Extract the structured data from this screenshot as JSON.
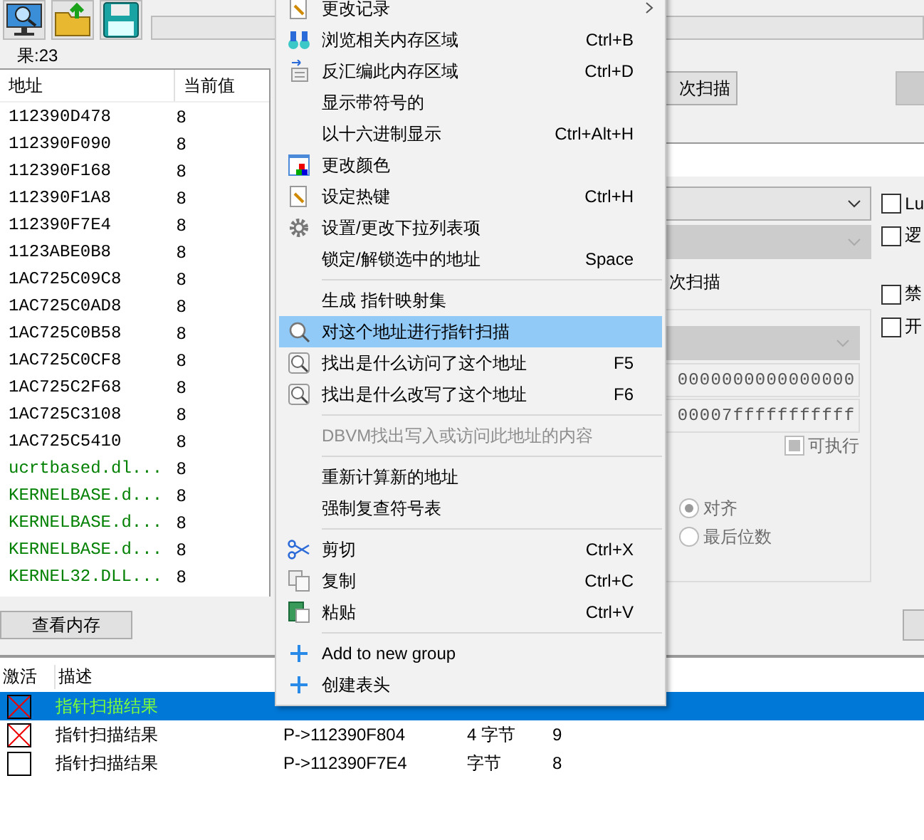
{
  "scan_progress": {
    "level": 0
  },
  "scan_results": {
    "count_label": "果:23",
    "columns": [
      "地址",
      "当前值"
    ],
    "rows": [
      {
        "address": "112390D478",
        "value": "8",
        "color": "#000000"
      },
      {
        "address": "112390F090",
        "value": "8",
        "color": "#000000"
      },
      {
        "address": "112390F168",
        "value": "8",
        "color": "#000000"
      },
      {
        "address": "112390F1A8",
        "value": "8",
        "color": "#000000"
      },
      {
        "address": "112390F7E4",
        "value": "8",
        "color": "#000000"
      },
      {
        "address": "1123ABE0B8",
        "value": "8",
        "color": "#000000"
      },
      {
        "address": "1AC725C09C8",
        "value": "8",
        "color": "#000000"
      },
      {
        "address": "1AC725C0AD8",
        "value": "8",
        "color": "#000000"
      },
      {
        "address": "1AC725C0B58",
        "value": "8",
        "color": "#000000"
      },
      {
        "address": "1AC725C0CF8",
        "value": "8",
        "color": "#000000"
      },
      {
        "address": "1AC725C2F68",
        "value": "8",
        "color": "#000000"
      },
      {
        "address": "1AC725C3108",
        "value": "8",
        "color": "#000000"
      },
      {
        "address": "1AC725C5410",
        "value": "8",
        "color": "#000000"
      },
      {
        "address": "ucrtbased.dl...",
        "value": "8",
        "color": "#008000"
      },
      {
        "address": "KERNELBASE.d...",
        "value": "8",
        "color": "#008000"
      },
      {
        "address": "KERNELBASE.d...",
        "value": "8",
        "color": "#008000"
      },
      {
        "address": "KERNELBASE.d...",
        "value": "8",
        "color": "#008000"
      },
      {
        "address": "KERNEL32.DLL...",
        "value": "8",
        "color": "#008000"
      }
    ],
    "view_memory_button": "查看内存"
  },
  "scan_panel": {
    "next_scan_button": "次扫描",
    "dropdowns": [
      {
        "disabled": false
      },
      {
        "disabled": true
      }
    ],
    "label": "次扫描",
    "options": [
      {
        "label": "Lu",
        "checked": false
      },
      {
        "label": "逻",
        "checked": false
      },
      {
        "label": "禁",
        "checked": false
      },
      {
        "label": "开",
        "checked": false
      }
    ],
    "memory_region": {
      "start": "0000000000000000",
      "stop": "00007fffffffffff",
      "executable_label": "可执行",
      "executable_checked": true,
      "radios": [
        {
          "label": "对齐",
          "selected": true
        },
        {
          "label": "最后位数",
          "selected": false
        }
      ]
    }
  },
  "context_menu": [
    {
      "kind": "item",
      "label": "更改记录",
      "selected": false,
      "disabled": false,
      "submenu": true
    },
    {
      "kind": "item",
      "label": "浏览相关内存区域",
      "shortcut": "Ctrl+B",
      "selected": false,
      "disabled": false,
      "submenu": false
    },
    {
      "kind": "item",
      "label": "反汇编此内存区域",
      "shortcut": "Ctrl+D",
      "selected": false,
      "disabled": false,
      "submenu": false
    },
    {
      "kind": "item",
      "label": "显示带符号的",
      "selected": false,
      "disabled": false,
      "submenu": false
    },
    {
      "kind": "item",
      "label": "以十六进制显示",
      "shortcut": "Ctrl+Alt+H",
      "selected": false,
      "disabled": false,
      "submenu": false
    },
    {
      "kind": "item",
      "label": "更改颜色",
      "selected": false,
      "disabled": false,
      "submenu": false
    },
    {
      "kind": "item",
      "label": "设定热键",
      "shortcut": "Ctrl+H",
      "selected": false,
      "disabled": false,
      "submenu": false
    },
    {
      "kind": "item",
      "label": "设置/更改下拉列表项",
      "selected": false,
      "disabled": false,
      "submenu": false
    },
    {
      "kind": "item",
      "label": "锁定/解锁选中的地址",
      "shortcut": "Space",
      "selected": false,
      "disabled": false,
      "submenu": false
    },
    {
      "kind": "separator"
    },
    {
      "kind": "item",
      "label": "生成 指针映射集",
      "selected": false,
      "disabled": false,
      "submenu": false
    },
    {
      "kind": "item",
      "label": "对这个地址进行指针扫描",
      "selected": true,
      "disabled": false,
      "submenu": false
    },
    {
      "kind": "item",
      "label": "找出是什么访问了这个地址",
      "shortcut": "F5",
      "selected": false,
      "disabled": false,
      "submenu": false
    },
    {
      "kind": "item",
      "label": "找出是什么改写了这个地址",
      "shortcut": "F6",
      "selected": false,
      "disabled": false,
      "submenu": false
    },
    {
      "kind": "separator"
    },
    {
      "kind": "item",
      "label": "DBVM找出写入或访问此地址的内容",
      "selected": false,
      "disabled": true,
      "submenu": false
    },
    {
      "kind": "separator"
    },
    {
      "kind": "item",
      "label": "重新计算新的地址",
      "selected": false,
      "disabled": false,
      "submenu": false
    },
    {
      "kind": "item",
      "label": "强制复查符号表",
      "selected": false,
      "disabled": false,
      "submenu": false
    },
    {
      "kind": "separator"
    },
    {
      "kind": "item",
      "label": "剪切",
      "shortcut": "Ctrl+X",
      "selected": false,
      "disabled": false,
      "submenu": false
    },
    {
      "kind": "item",
      "label": "复制",
      "shortcut": "Ctrl+C",
      "selected": false,
      "disabled": false,
      "submenu": false
    },
    {
      "kind": "item",
      "label": "粘贴",
      "shortcut": "Ctrl+V",
      "selected": false,
      "disabled": false,
      "submenu": false
    },
    {
      "kind": "separator"
    },
    {
      "kind": "item",
      "label": "Add to new group",
      "selected": false,
      "disabled": false,
      "submenu": false
    },
    {
      "kind": "item",
      "label": "创建表头",
      "selected": false,
      "disabled": false,
      "submenu": false
    }
  ],
  "address_list": {
    "columns": [
      "激活",
      "描述"
    ],
    "rows": [
      {
        "active": true,
        "selected": true,
        "description": "指针扫描结果"
      },
      {
        "active": true,
        "selected": false,
        "description": "指针扫描结果",
        "address": "P->112390F804",
        "type": "4 字节",
        "value": "9"
      },
      {
        "active": false,
        "selected": false,
        "description": "指针扫描结果",
        "address": "P->112390F7E4",
        "type": "字节",
        "value": "8"
      }
    ]
  }
}
